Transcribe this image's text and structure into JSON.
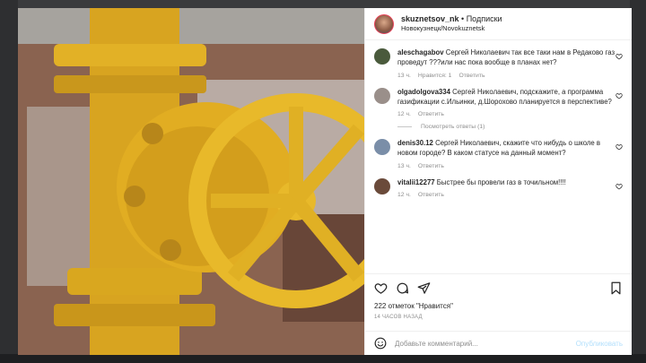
{
  "post": {
    "username": "skuznetsov_nk",
    "separator": " • ",
    "follow_label": "Подписки",
    "location": "Новокузнецк/Novokuznetsk",
    "likes_text": "222 отметок \"Нравится\"",
    "time_text": "14 ЧАСОВ НАЗАД"
  },
  "comments": [
    {
      "username": "aleschagabov",
      "text": "Сергей Николаевич так все таки нам в Редаково газ проведут ???или нас пока вообще в планах нет?",
      "time": "13 ч.",
      "likes": "Нравится: 1",
      "reply": "Ответить",
      "avatar_color": "#4a5a3c"
    },
    {
      "username": "olgadolgova334",
      "text": "Сергей Николаевич, подскажите, а программа газификации с.Ильинки, д.Шорохово планируется в перспективе?",
      "time": "12 ч.",
      "reply": "Ответить",
      "avatar_color": "#9a8f8a"
    },
    {
      "username": "denis30.12",
      "text": "Сергей Николаевич, скажите что нибудь о школе в новом городе? В каком статусе на данный момент?",
      "time": "13 ч.",
      "reply": "Ответить",
      "avatar_color": "#7a8ea8"
    },
    {
      "username": "vitalii12277",
      "text": "Быстрее бы провели газ в точильном!!!!",
      "time": "12 ч.",
      "reply": "Ответить",
      "avatar_color": "#6a4a3a"
    }
  ],
  "replies_label": "Посмотреть ответы (1)",
  "add_comment": {
    "placeholder": "Добавьте комментарий...",
    "post_label": "Опубликовать"
  },
  "colors": {
    "valve_yellow": "#e8b92a",
    "accent_blue": "#0095f6",
    "post_disabled": "#b2dffc"
  }
}
